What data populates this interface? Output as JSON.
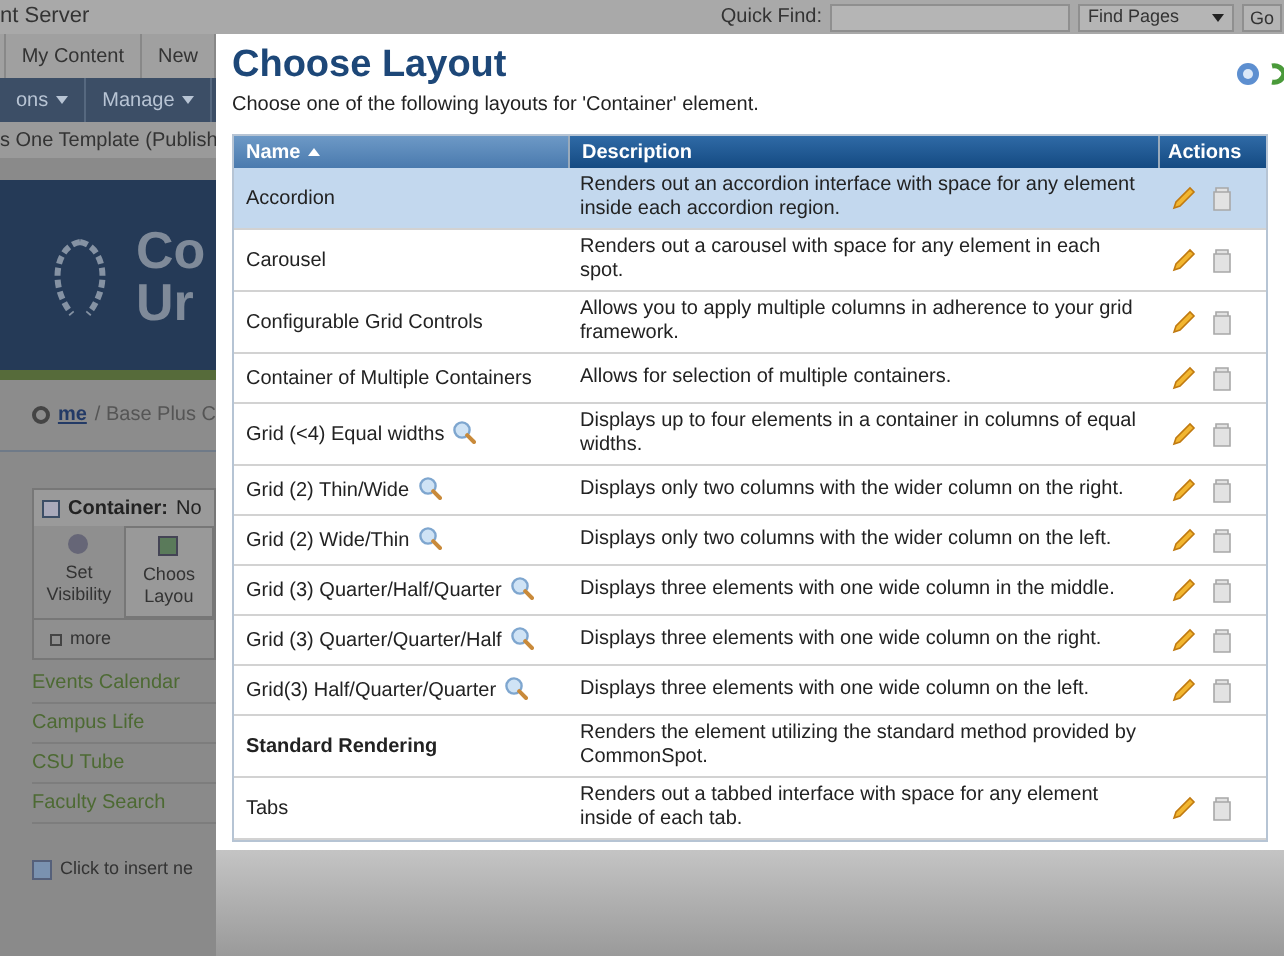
{
  "app": {
    "title": "nt Server",
    "quick_find": {
      "label": "Quick Find:",
      "scope": "Find Pages",
      "go": "Go"
    },
    "nav": [
      "My Content",
      "New"
    ],
    "menus": [
      "ons",
      "Manage"
    ],
    "page_title": "s One Template (Publish",
    "banner": [
      "Co",
      "Ur"
    ],
    "breadcrumb": {
      "home": "me",
      "path": "/ Base Plus C"
    },
    "container": {
      "label": "Container:",
      "value": "No",
      "tools": [
        {
          "label": "Set Visibility",
          "kind": "visibility"
        },
        {
          "label": "Choos Layou",
          "kind": "layout"
        }
      ],
      "more": "more"
    },
    "links": [
      "Events Calendar",
      "Campus Life",
      "CSU Tube",
      "Faculty Search"
    ],
    "insert": "Click to insert ne"
  },
  "dialog": {
    "title": "Choose Layout",
    "subtitle": "Choose one of the following layouts for 'Container' element.",
    "columns": [
      "Name",
      "Description",
      "Actions"
    ],
    "rows": [
      {
        "name": "Accordion",
        "description": "Renders out an accordion interface with space for any element inside each accordion region.",
        "preview": false,
        "bold": false,
        "actions": true,
        "selected": true
      },
      {
        "name": "Carousel",
        "description": "Renders out a carousel with space for any element in each spot.",
        "preview": false,
        "bold": false,
        "actions": true,
        "selected": false
      },
      {
        "name": "Configurable Grid Controls",
        "description": "Allows you to apply multiple columns in adherence to your grid framework.",
        "preview": false,
        "bold": false,
        "actions": true,
        "selected": false
      },
      {
        "name": "Container of Multiple Containers",
        "description": "Allows for selection of multiple containers.",
        "preview": false,
        "bold": false,
        "actions": true,
        "selected": false
      },
      {
        "name": "Grid (<4) Equal widths",
        "description": "Displays up to four elements in a container in columns of equal widths.",
        "preview": true,
        "bold": false,
        "actions": true,
        "selected": false
      },
      {
        "name": "Grid (2) Thin/Wide",
        "description": "Displays only two columns with the wider column on the right.",
        "preview": true,
        "bold": false,
        "actions": true,
        "selected": false
      },
      {
        "name": "Grid (2) Wide/Thin",
        "description": "Displays only two columns with the wider column on the left.",
        "preview": true,
        "bold": false,
        "actions": true,
        "selected": false
      },
      {
        "name": "Grid (3) Quarter/Half/Quarter",
        "description": "Displays three elements with one wide column in the middle.",
        "preview": true,
        "bold": false,
        "actions": true,
        "selected": false
      },
      {
        "name": "Grid (3) Quarter/Quarter/Half",
        "description": "Displays three elements with one wide column on the right.",
        "preview": true,
        "bold": false,
        "actions": true,
        "selected": false
      },
      {
        "name": "Grid(3) Half/Quarter/Quarter",
        "description": "Displays three elements with one wide column on the left.",
        "preview": true,
        "bold": false,
        "actions": true,
        "selected": false
      },
      {
        "name": "Standard Rendering",
        "description": "Renders the element utilizing the standard method provided by CommonSpot.",
        "preview": false,
        "bold": true,
        "actions": false,
        "selected": false
      },
      {
        "name": "Tabs",
        "description": "Renders out a tabbed interface with space for any element inside of each tab.",
        "preview": false,
        "bold": false,
        "actions": true,
        "selected": false
      }
    ]
  }
}
